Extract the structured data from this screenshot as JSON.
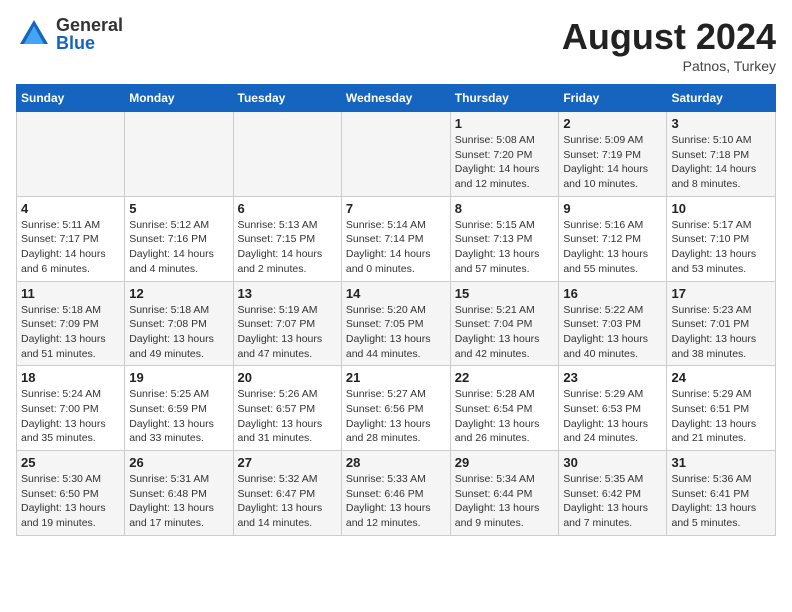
{
  "header": {
    "logo_general": "General",
    "logo_blue": "Blue",
    "month_year": "August 2024",
    "location": "Patnos, Turkey"
  },
  "days_of_week": [
    "Sunday",
    "Monday",
    "Tuesday",
    "Wednesday",
    "Thursday",
    "Friday",
    "Saturday"
  ],
  "weeks": [
    [
      {
        "day": "",
        "info": ""
      },
      {
        "day": "",
        "info": ""
      },
      {
        "day": "",
        "info": ""
      },
      {
        "day": "",
        "info": ""
      },
      {
        "day": "1",
        "info": "Sunrise: 5:08 AM\nSunset: 7:20 PM\nDaylight: 14 hours\nand 12 minutes."
      },
      {
        "day": "2",
        "info": "Sunrise: 5:09 AM\nSunset: 7:19 PM\nDaylight: 14 hours\nand 10 minutes."
      },
      {
        "day": "3",
        "info": "Sunrise: 5:10 AM\nSunset: 7:18 PM\nDaylight: 14 hours\nand 8 minutes."
      }
    ],
    [
      {
        "day": "4",
        "info": "Sunrise: 5:11 AM\nSunset: 7:17 PM\nDaylight: 14 hours\nand 6 minutes."
      },
      {
        "day": "5",
        "info": "Sunrise: 5:12 AM\nSunset: 7:16 PM\nDaylight: 14 hours\nand 4 minutes."
      },
      {
        "day": "6",
        "info": "Sunrise: 5:13 AM\nSunset: 7:15 PM\nDaylight: 14 hours\nand 2 minutes."
      },
      {
        "day": "7",
        "info": "Sunrise: 5:14 AM\nSunset: 7:14 PM\nDaylight: 14 hours\nand 0 minutes."
      },
      {
        "day": "8",
        "info": "Sunrise: 5:15 AM\nSunset: 7:13 PM\nDaylight: 13 hours\nand 57 minutes."
      },
      {
        "day": "9",
        "info": "Sunrise: 5:16 AM\nSunset: 7:12 PM\nDaylight: 13 hours\nand 55 minutes."
      },
      {
        "day": "10",
        "info": "Sunrise: 5:17 AM\nSunset: 7:10 PM\nDaylight: 13 hours\nand 53 minutes."
      }
    ],
    [
      {
        "day": "11",
        "info": "Sunrise: 5:18 AM\nSunset: 7:09 PM\nDaylight: 13 hours\nand 51 minutes."
      },
      {
        "day": "12",
        "info": "Sunrise: 5:18 AM\nSunset: 7:08 PM\nDaylight: 13 hours\nand 49 minutes."
      },
      {
        "day": "13",
        "info": "Sunrise: 5:19 AM\nSunset: 7:07 PM\nDaylight: 13 hours\nand 47 minutes."
      },
      {
        "day": "14",
        "info": "Sunrise: 5:20 AM\nSunset: 7:05 PM\nDaylight: 13 hours\nand 44 minutes."
      },
      {
        "day": "15",
        "info": "Sunrise: 5:21 AM\nSunset: 7:04 PM\nDaylight: 13 hours\nand 42 minutes."
      },
      {
        "day": "16",
        "info": "Sunrise: 5:22 AM\nSunset: 7:03 PM\nDaylight: 13 hours\nand 40 minutes."
      },
      {
        "day": "17",
        "info": "Sunrise: 5:23 AM\nSunset: 7:01 PM\nDaylight: 13 hours\nand 38 minutes."
      }
    ],
    [
      {
        "day": "18",
        "info": "Sunrise: 5:24 AM\nSunset: 7:00 PM\nDaylight: 13 hours\nand 35 minutes."
      },
      {
        "day": "19",
        "info": "Sunrise: 5:25 AM\nSunset: 6:59 PM\nDaylight: 13 hours\nand 33 minutes."
      },
      {
        "day": "20",
        "info": "Sunrise: 5:26 AM\nSunset: 6:57 PM\nDaylight: 13 hours\nand 31 minutes."
      },
      {
        "day": "21",
        "info": "Sunrise: 5:27 AM\nSunset: 6:56 PM\nDaylight: 13 hours\nand 28 minutes."
      },
      {
        "day": "22",
        "info": "Sunrise: 5:28 AM\nSunset: 6:54 PM\nDaylight: 13 hours\nand 26 minutes."
      },
      {
        "day": "23",
        "info": "Sunrise: 5:29 AM\nSunset: 6:53 PM\nDaylight: 13 hours\nand 24 minutes."
      },
      {
        "day": "24",
        "info": "Sunrise: 5:29 AM\nSunset: 6:51 PM\nDaylight: 13 hours\nand 21 minutes."
      }
    ],
    [
      {
        "day": "25",
        "info": "Sunrise: 5:30 AM\nSunset: 6:50 PM\nDaylight: 13 hours\nand 19 minutes."
      },
      {
        "day": "26",
        "info": "Sunrise: 5:31 AM\nSunset: 6:48 PM\nDaylight: 13 hours\nand 17 minutes."
      },
      {
        "day": "27",
        "info": "Sunrise: 5:32 AM\nSunset: 6:47 PM\nDaylight: 13 hours\nand 14 minutes."
      },
      {
        "day": "28",
        "info": "Sunrise: 5:33 AM\nSunset: 6:46 PM\nDaylight: 13 hours\nand 12 minutes."
      },
      {
        "day": "29",
        "info": "Sunrise: 5:34 AM\nSunset: 6:44 PM\nDaylight: 13 hours\nand 9 minutes."
      },
      {
        "day": "30",
        "info": "Sunrise: 5:35 AM\nSunset: 6:42 PM\nDaylight: 13 hours\nand 7 minutes."
      },
      {
        "day": "31",
        "info": "Sunrise: 5:36 AM\nSunset: 6:41 PM\nDaylight: 13 hours\nand 5 minutes."
      }
    ]
  ]
}
